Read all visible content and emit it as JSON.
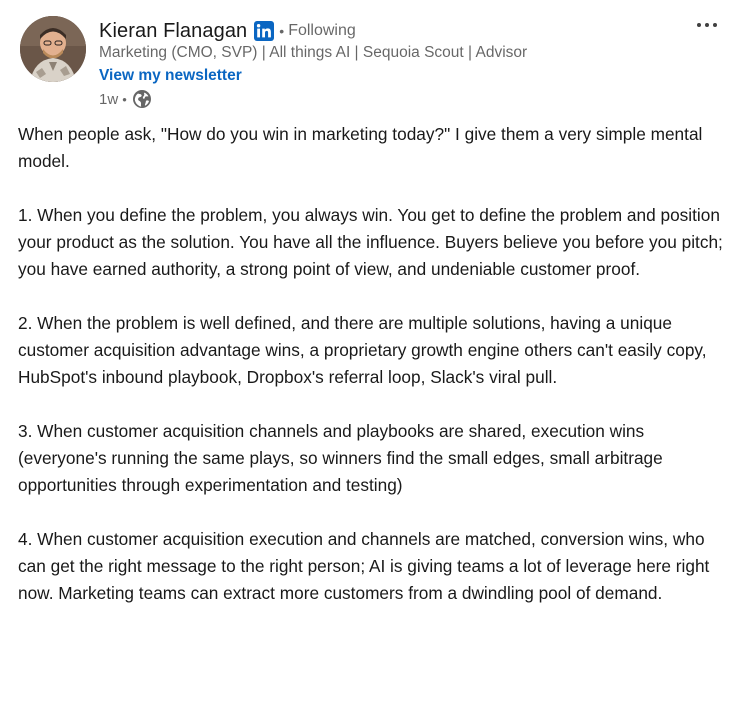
{
  "author": {
    "name": "Kieran Flanagan",
    "badge_icon": "linkedin-badge-icon",
    "follow_status": "Following",
    "headline": "Marketing (CMO, SVP) | All things AI | Sequoia Scout | Advisor",
    "newsletter_link": "View my newsletter",
    "time_ago": "1w",
    "visibility_icon": "globe-icon"
  },
  "menu": {
    "more_icon": "more-options-icon"
  },
  "post": {
    "paragraphs": [
      "When people ask, \"How do you win in marketing today?\" I give them a very simple mental model.",
      "1. When you define the problem, you always win. You get to define the problem and position your product as the solution. You have all the influence. Buyers believe you before you pitch; you have earned authority, a strong point of view, and undeniable customer proof.",
      "2. When the problem is well defined, and there are multiple solutions, having a unique customer acquisition advantage wins, a proprietary growth engine others can't easily copy, HubSpot's inbound playbook, Dropbox's referral loop, Slack's viral pull.",
      "3. When customer acquisition channels and playbooks are shared, execution wins (everyone's running the same plays, so winners find the small edges, small arbitrage opportunities through experimentation and testing)",
      "4. When customer acquisition execution and channels are matched, conversion wins, who can get the right message to the right person; AI is giving teams a lot of leverage here right now. Marketing teams can extract more customers from a dwindling pool of demand."
    ]
  },
  "colors": {
    "link_blue": "#0a66c2",
    "text_primary": "rgba(0,0,0,0.9)",
    "text_secondary": "rgba(0,0,0,0.6)"
  }
}
